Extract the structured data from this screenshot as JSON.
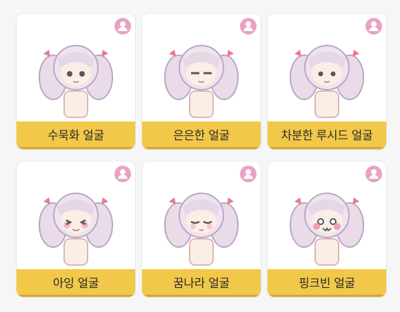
{
  "faces": [
    {
      "label": "수묵화 얼굴",
      "icon": "profile-icon",
      "expression": "calm"
    },
    {
      "label": "은은한 얼굴",
      "icon": "profile-icon",
      "expression": "sleepy"
    },
    {
      "label": "차분한 루시드 얼굴",
      "icon": "profile-icon",
      "expression": "neutral"
    },
    {
      "label": "아잉 얼굴",
      "icon": "profile-icon",
      "expression": "blush"
    },
    {
      "label": "꿈나라 얼굴",
      "icon": "profile-icon",
      "expression": "dreamy"
    },
    {
      "label": "핑크빈 얼굴",
      "icon": "profile-icon",
      "expression": "happy"
    }
  ],
  "colors": {
    "label_bg": "#f2c84a",
    "badge": "#e9a1c4",
    "hair": "#efe3ee",
    "hair_shadow": "#c9b6d3",
    "skin": "#fbeee7",
    "ribbon": "#e87a93"
  }
}
